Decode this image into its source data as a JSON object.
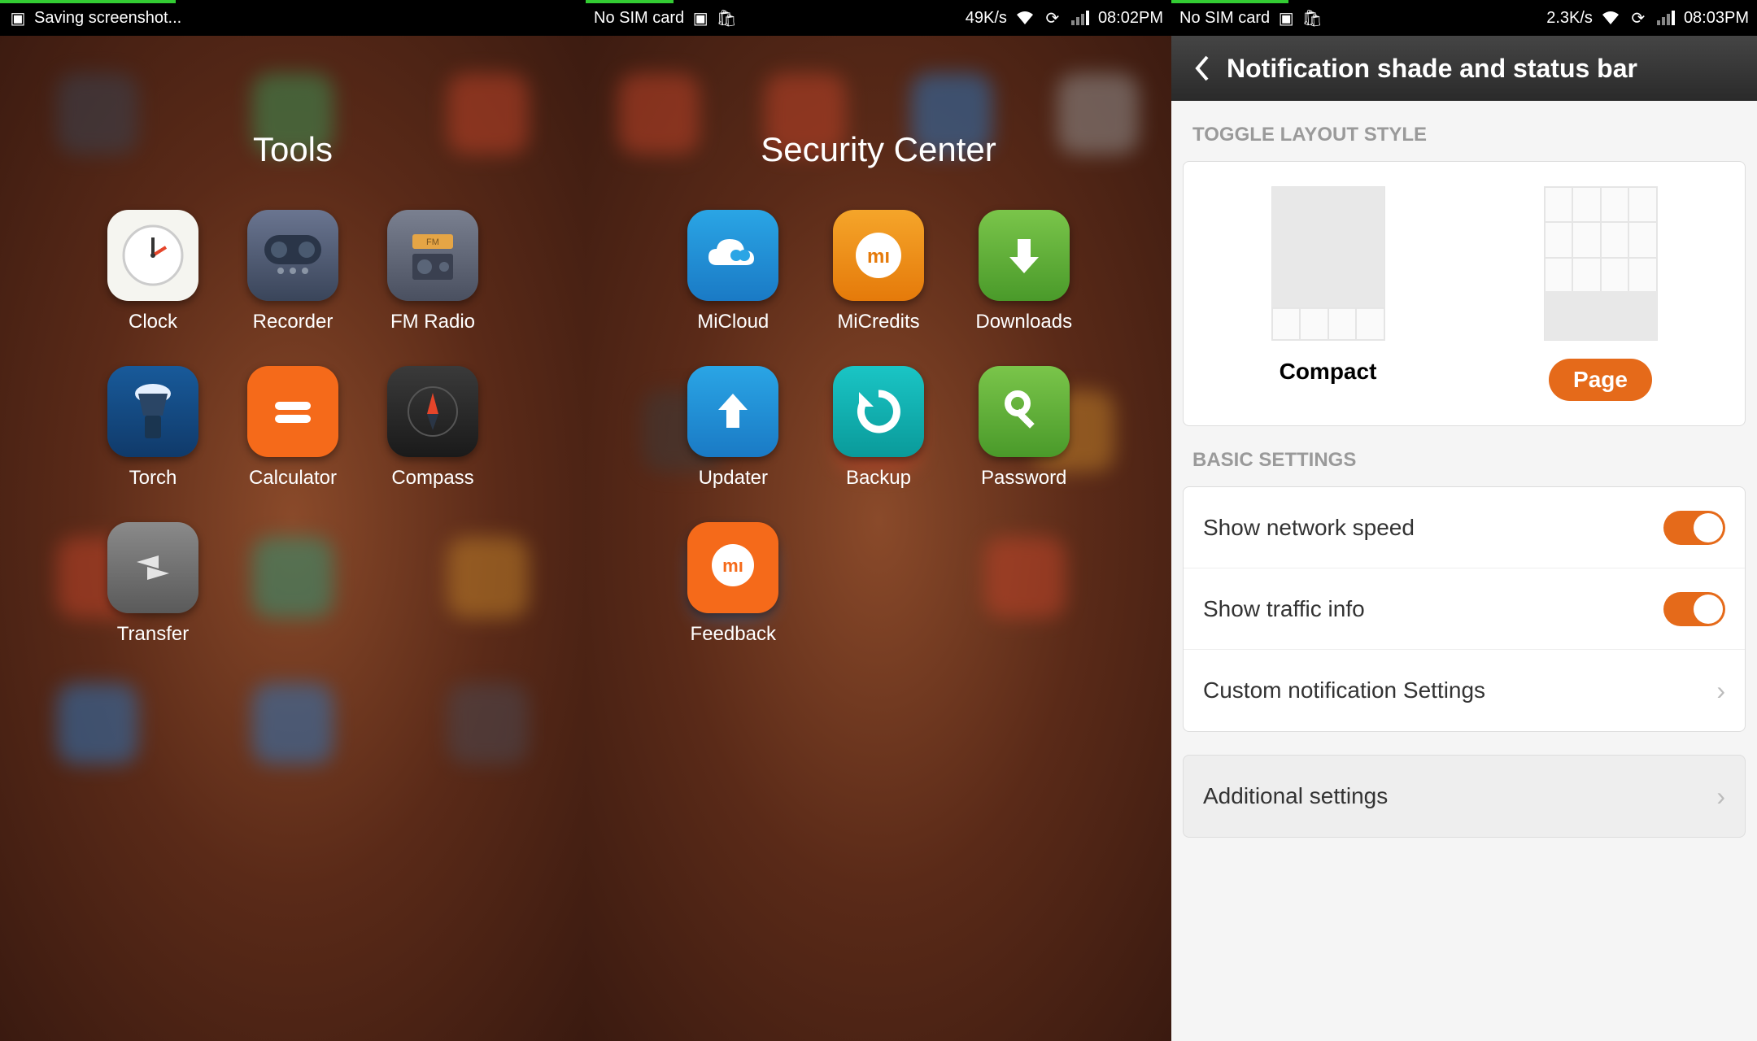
{
  "screens": {
    "p1": {
      "status": {
        "left_text": "Saving screenshot..."
      },
      "folder_title": "Tools",
      "apps": [
        "Clock",
        "Recorder",
        "FM Radio",
        "Torch",
        "Calculator",
        "Compass",
        "Transfer"
      ]
    },
    "p2": {
      "status": {
        "sim": "No SIM card",
        "speed": "49K/s",
        "time": "08:02PM"
      },
      "folder_title": "Security Center",
      "apps": [
        "MiCloud",
        "MiCredits",
        "Downloads",
        "Updater",
        "Backup",
        "Password",
        "Feedback"
      ]
    },
    "p3": {
      "status": {
        "sim": "No SIM card",
        "speed": "2.3K/s",
        "time": "08:03PM"
      },
      "header_title": "Notification shade and status bar",
      "section1": "TOGGLE LAYOUT STYLE",
      "layout_compact": "Compact",
      "layout_page": "Page",
      "section2": "BASIC SETTINGS",
      "row_network": "Show network speed",
      "row_traffic": "Show traffic info",
      "row_custom": "Custom notification Settings",
      "row_additional": "Additional settings"
    }
  }
}
